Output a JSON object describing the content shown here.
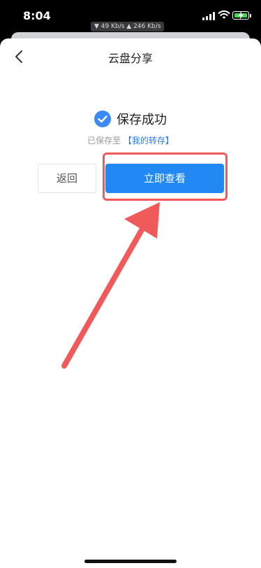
{
  "status_bar": {
    "time": "8:04",
    "net_speed": "▼ 49 Kb/s  ▲ 246 Kb/s"
  },
  "nav": {
    "title": "云盘分享",
    "back_icon": "chevron-left-icon"
  },
  "result": {
    "icon": "check-circle-icon",
    "title": "保存成功",
    "saved_prefix": "已保存至",
    "saved_link": "【我的转存】"
  },
  "actions": {
    "return_label": "返回",
    "view_label": "立即查看"
  },
  "colors": {
    "accent": "#2288f4",
    "link": "#2b7cf6",
    "annotation": "#f05a5a"
  }
}
